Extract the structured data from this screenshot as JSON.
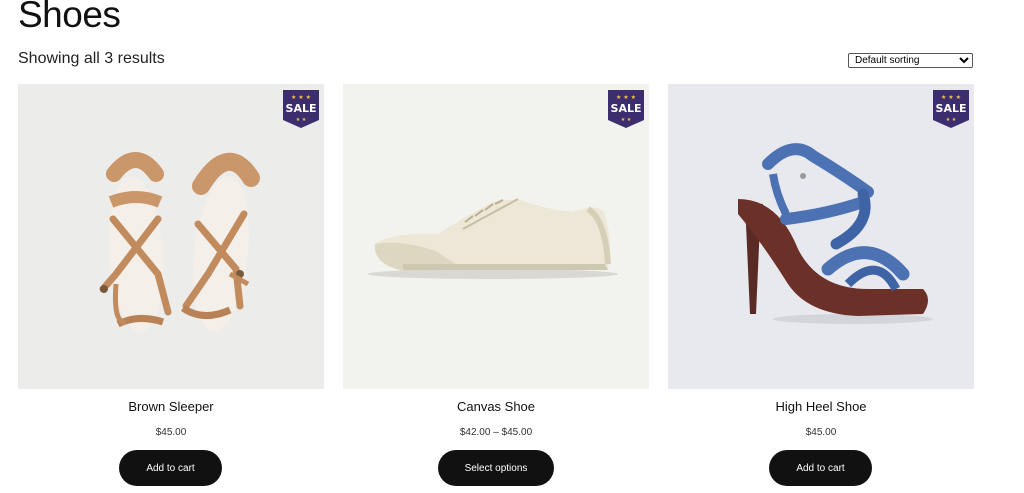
{
  "page": {
    "title": "Shoes"
  },
  "results": {
    "count_text": "Showing all 3 results"
  },
  "sorting": {
    "selected": "Default sorting"
  },
  "colors": {
    "button_bg": "#111111",
    "badge_bg": "#3b2d6e",
    "badge_star": "#f5c344"
  },
  "products": [
    {
      "name": "Brown Sleeper",
      "price": "$45.00",
      "button": "Add to cart",
      "badge": "SALE",
      "image_icon": "sandals-image"
    },
    {
      "name": "Canvas Shoe",
      "price": "$42.00 – $45.00",
      "button": "Select options",
      "badge": "SALE",
      "image_icon": "sneaker-image"
    },
    {
      "name": "High Heel Shoe",
      "price": "$45.00",
      "button": "Add to cart",
      "badge": "SALE",
      "image_icon": "high-heel-image"
    }
  ]
}
